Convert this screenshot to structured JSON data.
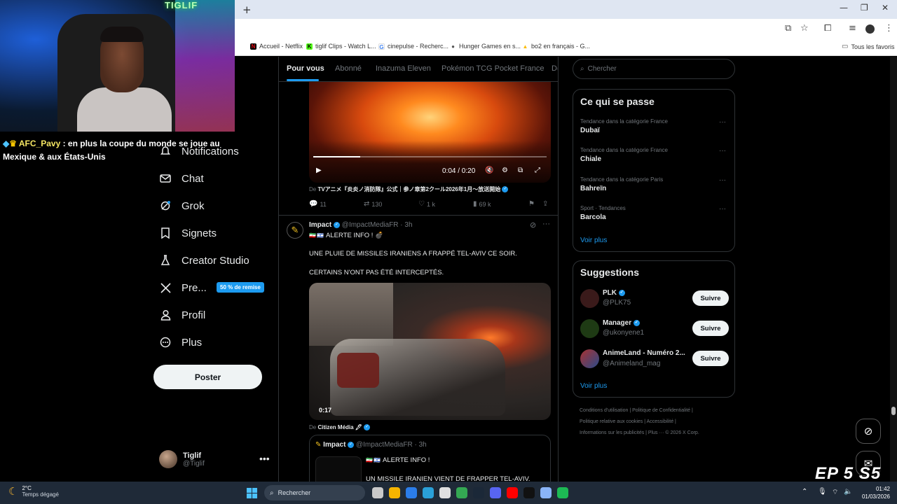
{
  "browser": {
    "new_tab_icon": "+",
    "window_controls": [
      "—",
      "❐",
      "✕"
    ],
    "bookmarks": [
      {
        "label": "Accueil - Netflix",
        "color": "#e50914",
        "icon": "N"
      },
      {
        "label": "tiglif Clips - Watch L...",
        "color": "#53fc18",
        "icon": "K"
      },
      {
        "label": "cinepulse - Recherc...",
        "color": "#4285f4",
        "icon": "G"
      },
      {
        "label": "Hunger Games en s...",
        "color": "#555555",
        "icon": "●"
      },
      {
        "label": "bo2 en français - G...",
        "color": "#fbbc04",
        "icon": "▲"
      }
    ],
    "all_bookmarks": "Tous les favoris"
  },
  "nav": {
    "items": [
      {
        "label": "Notifications",
        "icon": "bell-icon"
      },
      {
        "label": "Chat",
        "icon": "mail-icon"
      },
      {
        "label": "Grok",
        "icon": "grok-icon"
      },
      {
        "label": "Signets",
        "icon": "bookmark-icon"
      },
      {
        "label": "Creator Studio",
        "icon": "flask-icon"
      },
      {
        "label": "Pre...",
        "icon": "x-logo-icon"
      },
      {
        "label": "Profil",
        "icon": "person-icon"
      },
      {
        "label": "Plus",
        "icon": "more-circle-icon"
      }
    ],
    "promo_badge": "50 % de remise",
    "post_button": "Poster",
    "account": {
      "name": "Tiglif",
      "handle": "@Tiglif",
      "more": "•••"
    }
  },
  "feed": {
    "tabs": [
      "Pour vous",
      "Abonné",
      "Inazuma Eleven",
      "Pokémon TCG Pocket France",
      "D("
    ],
    "video1": {
      "time": "0:04 / 0:20",
      "progress": 0.2
    },
    "video1_source_prefix": "De ",
    "video1_source": "TVアニメ『炎炎ノ消防隊』公式｜参ノ章第2クール2026年1月～放送開始",
    "video1_stats": {
      "replies": "11",
      "reposts": "130",
      "likes": "1 k",
      "views": "69 k"
    },
    "tweet": {
      "name": "Impact",
      "handle": "@ImpactMediaFR · 3h",
      "flags": "🇮🇷🇮🇱",
      "line1": "ALERTE INFO ! 💣",
      "line2": "UNE PLUIE DE MISSILES IRANIENS A FRAPPÉ TEL-AVIV CE SOIR.",
      "line3": "CERTAINS N'ONT PAS ÉTÉ INTERCEPTÉS.",
      "video_duration": "0:17",
      "source_prefix": "De ",
      "source": "Citizen Média 🖋"
    },
    "quote": {
      "name": "Impact",
      "handle": "@ImpactMediaFR · 3h",
      "line1": "ALERTE INFO !",
      "line2": "UN MISSILE IRANIEN VIENT DE FRAPPER TEL-AVIV."
    }
  },
  "right": {
    "search_placeholder": "Chercher",
    "trends_title": "Ce qui se passe",
    "trends": [
      {
        "meta": "Tendance dans la catégorie France",
        "name": "Dubaï"
      },
      {
        "meta": "Tendance dans la catégorie France",
        "name": "Chiale"
      },
      {
        "meta": "Tendance dans la catégorie Paris",
        "name": "Bahreïn"
      },
      {
        "meta": "Sport · Tendances",
        "name": "Barcola"
      }
    ],
    "see_more": "Voir plus",
    "suggestions_title": "Suggestions",
    "suggestions": [
      {
        "name": "PLK",
        "handle": "@PLK75",
        "color": "#3a1a1a"
      },
      {
        "name": "Manager",
        "handle": "@ukonyene1",
        "color": "#1e3a14"
      },
      {
        "name": "AnimeLand - Numéro 2...",
        "handle": "@Animeland_mag",
        "color": "#a83232"
      }
    ],
    "follow_label": "Suivre",
    "footer": [
      "Conditions d'utilisation  |  Politique de Confidentialité  |",
      "Politique relative aux cookies  |  Accessibilité  |",
      "Informations sur les publicités  |  Plus ···  © 2026 X Corp."
    ]
  },
  "stream": {
    "sign": "TIGLIF",
    "chat_user": "AFC_Pavy",
    "chat_message": " : en plus la coupe du monde se joue au Mexique & aux États-Unis",
    "episode": "EP 5 S5"
  },
  "taskbar": {
    "temp": "2°C",
    "weather": "Temps dégagé",
    "search": "Rechercher",
    "time": "01:42",
    "date": "01/03/2026",
    "apps": [
      "#c9c9c9",
      "#f5b400",
      "#2b7de9",
      "#2aa0d8",
      "#e0e0e0",
      "#34a853",
      "#1b2838",
      "#5865f2",
      "#ff0000",
      "#111111",
      "#8ab4f8",
      "#1db954"
    ]
  }
}
